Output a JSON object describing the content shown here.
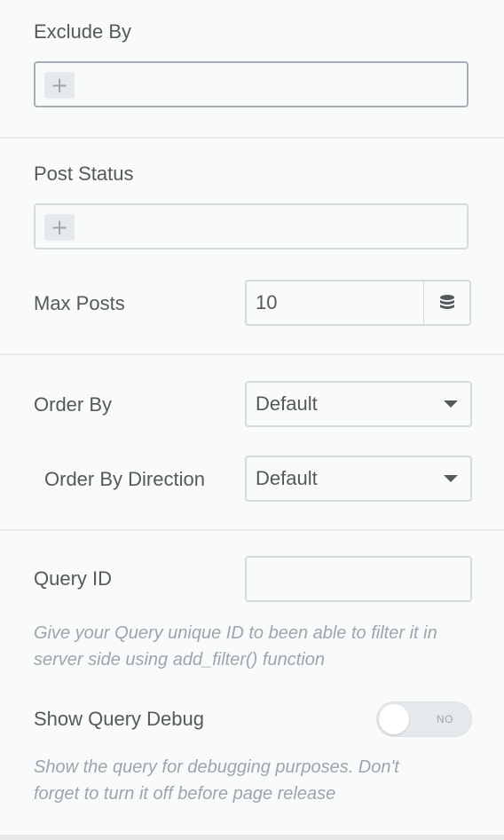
{
  "exclude_by": {
    "label": "Exclude By",
    "add_symbol": "+"
  },
  "post_status": {
    "label": "Post Status",
    "add_symbol": "+"
  },
  "max_posts": {
    "label": "Max Posts",
    "value": "10",
    "icon": "database-icon"
  },
  "order_by": {
    "label": "Order By",
    "value": "Default"
  },
  "order_direction": {
    "label": "Order By Direction",
    "value": "Default"
  },
  "query_id": {
    "label": "Query ID",
    "value": "",
    "help_line1": "Give your Query unique ID to been able to filter it in",
    "help_line2": "server side using add_filter() function"
  },
  "query_debug": {
    "label": "Show Query Debug",
    "toggle_text": "NO",
    "help_line1": "Show the query for debugging purposes. Don't",
    "help_line2": "forget to turn it off before page release"
  }
}
